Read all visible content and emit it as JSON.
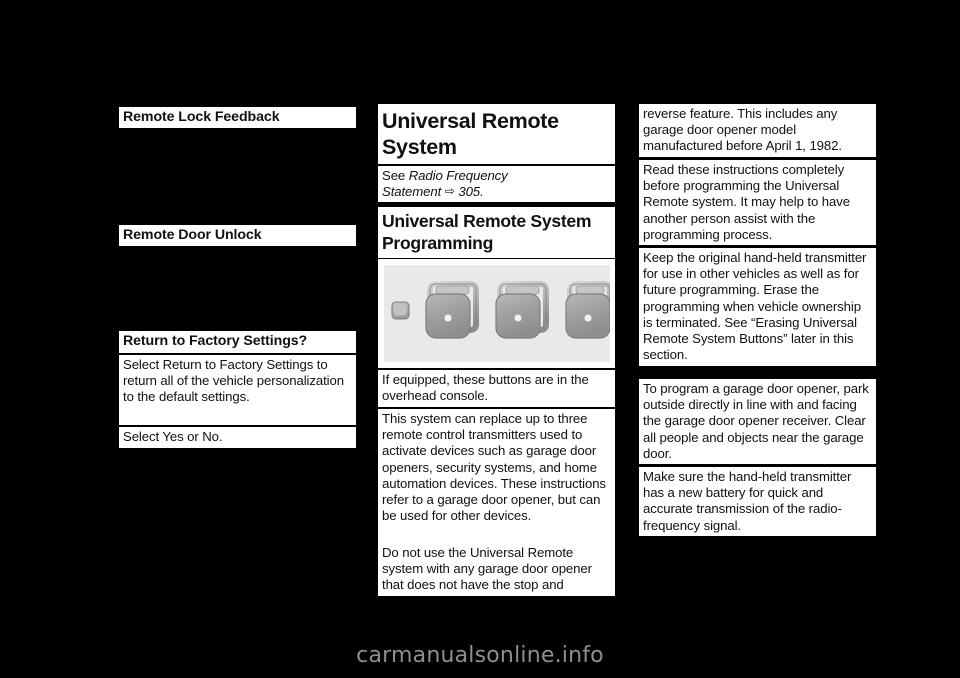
{
  "page": {
    "background_color": "#000000",
    "block_color": "#ffffff",
    "text_color": "#111111"
  },
  "columns": {
    "left": {
      "blocks": [
        {
          "type": "heading",
          "text": "Remote Lock Feedback"
        },
        {
          "type": "heading",
          "text": "Remote Door Unlock"
        },
        {
          "type": "heading",
          "text": "Return to Factory Settings?"
        },
        {
          "type": "body",
          "text": "Select Return to Factory Settings to return all of the vehicle personalization to the default settings."
        },
        {
          "type": "body",
          "text": "Select Yes or No."
        }
      ]
    },
    "middle": {
      "title": "Universal Remote System",
      "title_line_1": "Universal Remote",
      "title_line_2": "System",
      "xref": {
        "lead": "See ",
        "ref_line_1": "Radio Frequency",
        "ref_line_2": "Statement",
        "arrow": "⇨",
        "page": "305."
      },
      "subheading_line_1": "Universal Remote System",
      "subheading_line_2": "Programming",
      "figure": {
        "name": "overhead-console-universal-remote-buttons",
        "indicator_label": "led-indicator",
        "button_count": 3,
        "background_color": "#e9e9e9"
      },
      "blocks": [
        {
          "type": "body",
          "text": "If equipped, these buttons are in the overhead console."
        },
        {
          "type": "body",
          "text": "This system can replace up to three remote control transmitters used to activate devices such as garage door openers, security systems, and home automation devices. These instructions refer to a garage door opener, but can be used for other devices."
        },
        {
          "type": "body",
          "text": "Do not use the Universal Remote system with any garage door opener that does not have the stop and"
        }
      ]
    },
    "right": {
      "blocks": [
        {
          "type": "body",
          "text": "reverse feature. This includes any garage door opener model manufactured before April 1, 1982."
        },
        {
          "type": "body",
          "text": "Read these instructions completely before programming the Universal Remote system. It may help to have another person assist with the programming process."
        },
        {
          "type": "body",
          "text": "Keep the original hand-held transmitter for use in other vehicles as well as for future programming. Erase the programming when vehicle ownership is terminated. See “Erasing Universal Remote System Buttons” later in this section."
        },
        {
          "type": "body",
          "text": "To program a garage door opener, park outside directly in line with and facing the garage door opener receiver. Clear all people and objects near the garage door."
        },
        {
          "type": "body",
          "text": "Make sure the hand-held transmitter has a new battery for quick and accurate transmission of the radio-frequency signal."
        }
      ]
    }
  },
  "footer": {
    "watermark": "carmanualsonline.info"
  }
}
